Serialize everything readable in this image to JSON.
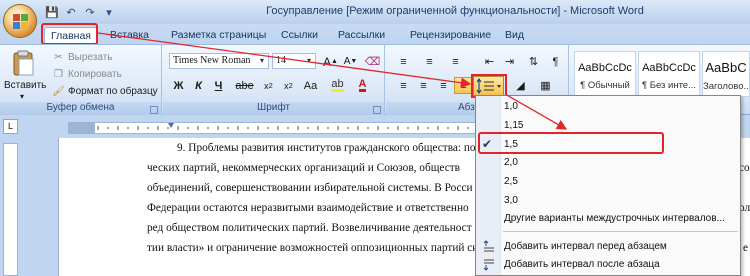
{
  "window": {
    "title": "Госуправление [Режим ограниченной функциональности] - Microsoft Word"
  },
  "tabs": [
    {
      "label": "Главная",
      "active": true
    },
    {
      "label": "Вставка"
    },
    {
      "label": "Разметка страницы"
    },
    {
      "label": "Ссылки"
    },
    {
      "label": "Рассылки"
    },
    {
      "label": "Рецензирование"
    },
    {
      "label": "Вид"
    }
  ],
  "clipboard": {
    "paste": "Вставить",
    "cut": "Вырезать",
    "copy": "Копировать",
    "format_painter": "Формат по образцу",
    "group_label": "Буфер обмена"
  },
  "font": {
    "name": "Times New Roman",
    "size": "14",
    "bold": "Ж",
    "italic": "К",
    "underline": "Ч",
    "group_label": "Шрифт"
  },
  "paragraph": {
    "group_label": "Абза"
  },
  "styles": [
    {
      "sample": "AaBbCcDc",
      "name": "¶ Обычный"
    },
    {
      "sample": "AaBbCcDc",
      "name": "¶ Без инте..."
    },
    {
      "sample": "AaBbC",
      "name": "Заголово..."
    }
  ],
  "line_spacing_menu": {
    "options": [
      "1,0",
      "1,15",
      "1,5",
      "2,0",
      "2,5",
      "3,0"
    ],
    "selected": "1,5",
    "more": "Другие варианты междустрочных интервалов...",
    "add_before": "Добавить интервал перед абзацем",
    "add_after": "Добавить интервал после абзаца"
  },
  "document": {
    "lines": [
      "9. Проблемы развития институтов гражданского общества: по",
      "ческих партий, некоммерческих организаций и Союзов, обществ",
      "объединений, совершенствовании избирательной системы. В Росси",
      "Федерации остаются неразвитыми взаимодействие и ответственно",
      "ред обществом политических партий. Возвеличивание деятельност",
      "тии власти» и ограничение возможностей оппозиционных партий сни"
    ],
    "right_fragments": [
      "со",
      "ол",
      "е"
    ]
  },
  "colors": {
    "accent_red": "#e2252b",
    "ribbon_blue": "#dbe7f7",
    "highlight": "#f8c453"
  }
}
